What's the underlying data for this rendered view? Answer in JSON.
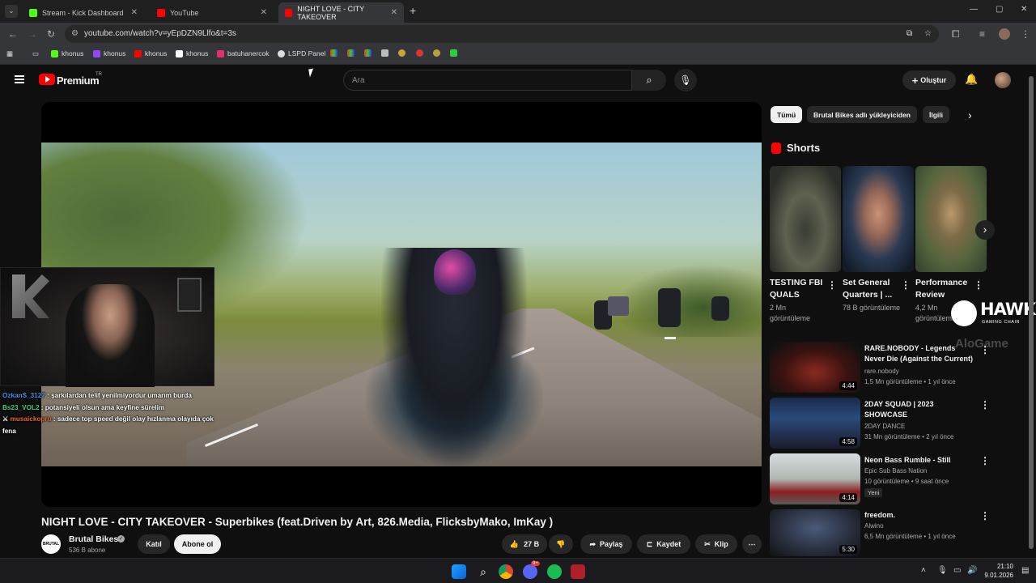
{
  "browser": {
    "tabs": [
      {
        "label": "Stream - Kick Dashboard",
        "color": "#53fc18"
      },
      {
        "label": "YouTube",
        "color": "#ff0000"
      },
      {
        "label": "NIGHT LOVE - CITY TAKEOVER",
        "color": "#ff0000"
      }
    ],
    "new_tab": "+",
    "url": "youtube.com/watch?v=yEpDZN9Llfo&t=3s",
    "bookmarks": [
      {
        "label": "khonus",
        "color": "#53fc18"
      },
      {
        "label": "khonus",
        "color": "#9146ff"
      },
      {
        "label": "khonus",
        "color": "#ff0000"
      },
      {
        "label": "khonus",
        "color": "#ffffff"
      },
      {
        "label": "batuhanercok",
        "color": "#e1306c"
      },
      {
        "label": "LSPD Panel",
        "color": "#ffffff"
      }
    ]
  },
  "header": {
    "brand": "Premium",
    "region": "TR",
    "search_placeholder": "Ara",
    "create_label": "Oluştur"
  },
  "video": {
    "title": "NIGHT LOVE - CITY TAKEOVER - Superbikes (feat.Driven by Art, 826.Media, FlicksbyMako, ImKay )",
    "channel": "Brutal Bikes",
    "channel_logo_text": "BRUTAL BIKES",
    "subscribers": "536 B abone",
    "join_label": "Katıl",
    "subscribe_label": "Abone ol",
    "likes": "27 B",
    "share_label": "Paylaş",
    "save_label": "Kaydet",
    "clip_label": "Klip"
  },
  "chat": [
    {
      "user": "OzkanS_3127",
      "text": ": şarkılardan telif yenilmiyordur umarım burda"
    },
    {
      "user": "Bs23_VOL2",
      "text": ": potansiyeli olsun ama keyfine sürelim"
    },
    {
      "user": "musaickopru",
      "text": ": sadece top speed değil olay hızlanma olayıda çok fena"
    }
  ],
  "chips": [
    "Tümü",
    "Brutal Bikes adlı yükleyiciden",
    "İlgili"
  ],
  "shorts_heading": "Shorts",
  "shorts": [
    {
      "title": "TESTING FBI QUALS",
      "views": "2 Mn görüntüleme"
    },
    {
      "title": "Set General Quarters | ...",
      "views": "78 B görüntüleme"
    },
    {
      "title": "Performance Review",
      "views": "4,2 Mn görüntüleme"
    }
  ],
  "recommendations": [
    {
      "title": "RARE.NOBODY - Legends Never Die (Against the Current)",
      "channel": "rare.nobody",
      "meta": "1,5 Mn görüntüleme • 1 yıl önce",
      "duration": "4:44"
    },
    {
      "title": "2DAY SQUAD | 2023 SHOWCASE",
      "channel": "2DAY DANCE",
      "meta": "31 Mn görüntüleme • 2 yıl önce",
      "duration": "4:58"
    },
    {
      "title": "Neon Bass Rumble - Still",
      "channel": "Epic Sub Bass Nation",
      "meta": "10 görüntüleme • 9 saat önce",
      "duration": "4:14",
      "badge": "Yeni"
    },
    {
      "title": "freedom.",
      "channel": "Alwino",
      "meta": "6,5 Mn görüntüleme • 1 yıl önce",
      "duration": "5:30"
    }
  ],
  "overlay": {
    "brand": "HAWK",
    "tagline": "GAMING CHAIR",
    "watermark": "AloGame"
  },
  "taskbar": {
    "time": "21:10",
    "date": "9.01.2026",
    "discord_badge": "9+"
  }
}
